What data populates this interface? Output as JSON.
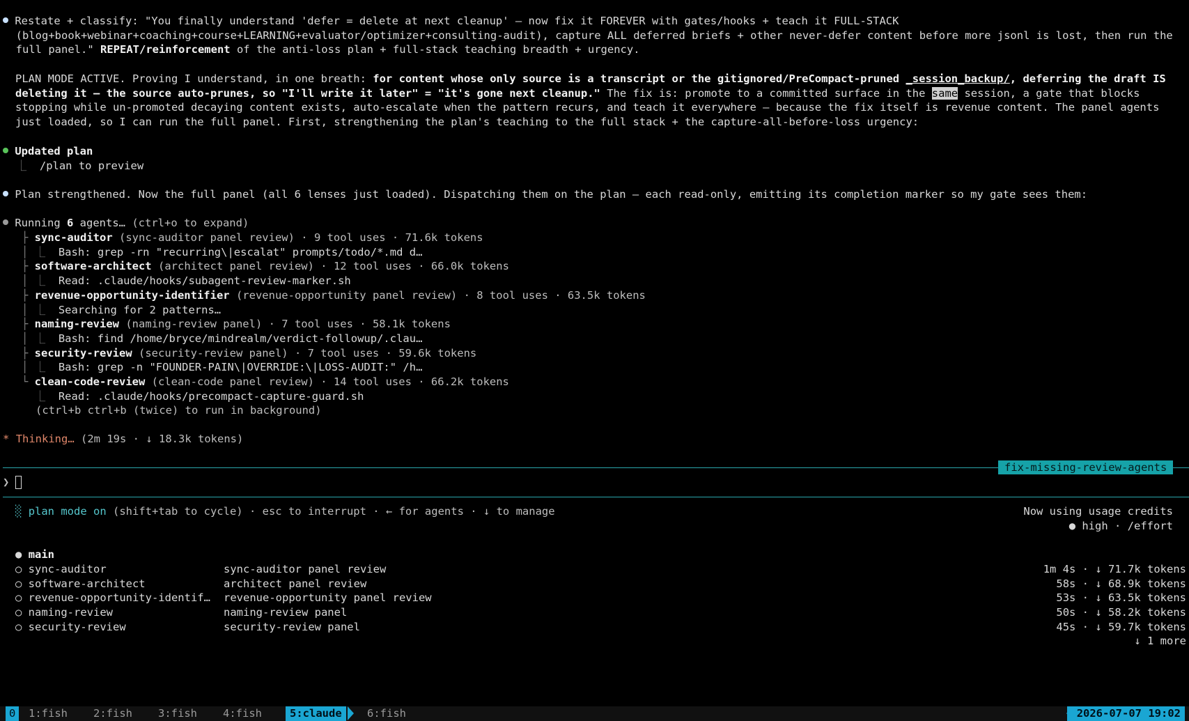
{
  "conversation": {
    "user_msg": {
      "line1": "Restate + classify: \"You finally understand 'defer = delete at next cleanup' — now fix it FOREVER with gates/hooks + teach it FULL-STACK",
      "line2": "(blog+book+webinar+coaching+course+LEARNING+evaluator/optimizer+consulting-audit), capture ALL deferred briefs + other never-defer content before more jsonl is lost, then run the",
      "line3_a": "full panel.\" ",
      "line3_b": "REPEAT/reinforcement",
      "line3_c": " of the anti-loss plan + full-stack teaching breadth + urgency."
    },
    "plan_para": {
      "l1_a": "PLAN MODE ACTIVE. Proving I understand, in one breath: ",
      "l1_b": "for content whose only source is a transcript or the gitignored/PreCompact-pruned ",
      "l1_c": "_session_backup/",
      "l1_d": ", deferring the draft IS",
      "l2_a": "deleting it — the source auto-prunes, so \"I'll write it later\" = \"it's gone next cleanup.\"",
      "l2_b": " The fix is: promote to a committed surface in the ",
      "l2_c": "same",
      "l2_d": " session, a gate that blocks",
      "l3": "stopping while un-promoted decaying content exists, auto-escalate when the pattern recurs, and teach it everywhere — because the fix itself is revenue content. The panel agents",
      "l4": "just loaded, so I can run the full panel. First, strengthening the plan's teaching to the full stack + the capture-all-before-loss urgency:"
    },
    "updated_plan": {
      "title": "Updated plan",
      "sub": "/plan to preview"
    },
    "strengthened": "Plan strengthened. Now the full panel (all 6 lenses just loaded). Dispatching them on the plan — each read-only, emitting its completion marker so my gate sees them:",
    "running": {
      "prefix": "Running ",
      "count": "6",
      "suffix": " agents…",
      "hint": " (ctrl+o to expand)"
    },
    "agents": [
      {
        "name": "sync-auditor",
        "desc": " (sync-auditor panel review) · 9 tool uses · 71.6k tokens",
        "activity": "Bash: grep -rn \"recurring\\|escalat\" prompts/todo/*.md d…"
      },
      {
        "name": "software-architect",
        "desc": " (architect panel review) · 12 tool uses · 66.0k tokens",
        "activity": "Read: .claude/hooks/subagent-review-marker.sh"
      },
      {
        "name": "revenue-opportunity-identifier",
        "desc": " (revenue-opportunity panel review) · 8 tool uses · 63.5k tokens",
        "activity": "Searching for 2 patterns…"
      },
      {
        "name": "naming-review",
        "desc": " (naming-review panel) · 7 tool uses · 58.1k tokens",
        "activity": "Bash: find /home/bryce/mindrealm/verdict-followup/.clau…"
      },
      {
        "name": "security-review",
        "desc": " (security-review panel) · 7 tool uses · 59.6k tokens",
        "activity": "Bash: grep -n \"FOUNDER-PAIN\\|OVERRIDE:\\|LOSS-AUDIT:\" /h…"
      },
      {
        "name": "clean-code-review",
        "desc": " (clean-code panel review) · 14 tool uses · 66.2k tokens",
        "activity": "Read: .claude/hooks/precompact-capture-guard.sh"
      }
    ],
    "background_hint": "(ctrl+b ctrl+b (twice) to run in background)",
    "thinking": {
      "star": "*",
      "label": "Thinking…",
      "meta": " (2m 19s · ↓ 18.3k tokens)"
    }
  },
  "prompt": {
    "symbol": "❯",
    "value": "",
    "branch": "fix-missing-review-agents"
  },
  "footer": {
    "mode_icon": "░",
    "mode_label": "plan mode on",
    "mode_hint": " (shift+tab to cycle) · esc to interrupt · ← for agents · ↓ to manage",
    "usage": "Now using usage credits",
    "effort": "● high · /effort"
  },
  "agent_list": {
    "main": "main",
    "rows": [
      {
        "name": "sync-auditor",
        "desc": "sync-auditor panel review",
        "stats": "1m 4s · ↓ 71.7k tokens"
      },
      {
        "name": "software-architect",
        "desc": "architect panel review",
        "stats": "58s · ↓ 68.9k tokens"
      },
      {
        "name": "revenue-opportunity-identif…",
        "desc": "revenue-opportunity panel review",
        "stats": "53s · ↓ 63.5k tokens"
      },
      {
        "name": "naming-review",
        "desc": "naming-review panel",
        "stats": "50s · ↓ 58.2k tokens"
      },
      {
        "name": "security-review",
        "desc": "security-review panel",
        "stats": "45s · ↓ 59.7k tokens"
      }
    ],
    "more": "↓ 1 more"
  },
  "tmux": {
    "session": "0",
    "windows": [
      "1:fish",
      "2:fish",
      "3:fish",
      "4:fish",
      "5:claude",
      "6:fish"
    ],
    "active_index": 4,
    "datetime": "2026-07-07 19:02"
  },
  "colors": {
    "accent": "#1aa6d3",
    "teal": "#16a2a8",
    "thinking": "#e0876a",
    "bullet_green": "#59c35a",
    "bullet_blue": "#c8e1ff"
  }
}
